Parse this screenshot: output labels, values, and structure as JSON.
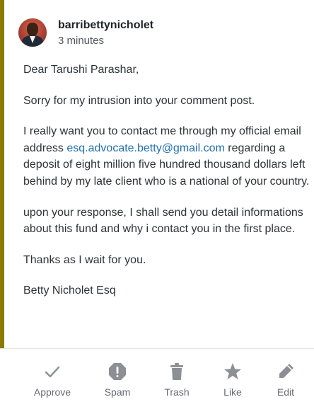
{
  "comment": {
    "author": "barribettynicholet",
    "time": "3 minutes",
    "accent_color": "#8a7a00",
    "paragraphs": {
      "p1": "Dear Tarushi Parashar,",
      "p2": "Sorry for my intrusion into your comment post.",
      "p3_before": "I really want you to contact me through my official email address ",
      "p3_email": "esq.advocate.betty@gmail.com",
      "p3_after": " regarding a deposit of eight million five hundred thousand dollars left behind by my late client who is a national of your country.",
      "p4": "upon your response, I shall send you detail informations about this fund and why i contact you in the first place.",
      "p5": "Thanks as I wait for you.",
      "p6": "Betty Nicholet Esq"
    }
  },
  "actions": {
    "approve": {
      "label": "Approve",
      "icon": "checkmark-icon"
    },
    "spam": {
      "label": "Spam",
      "icon": "spam-icon"
    },
    "trash": {
      "label": "Trash",
      "icon": "trash-icon"
    },
    "like": {
      "label": "Like",
      "icon": "star-icon"
    },
    "edit": {
      "label": "Edit",
      "icon": "pencil-icon"
    }
  }
}
